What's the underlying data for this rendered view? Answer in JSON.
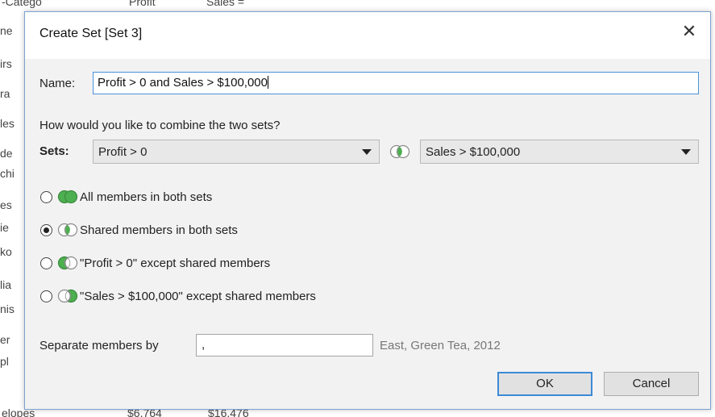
{
  "background": {
    "header_cols": [
      "-Catego",
      "Profit",
      "Sales ="
    ],
    "row_fragments": [
      "ne",
      "irs",
      "ra",
      "les",
      "de",
      "chi",
      "es",
      "ie",
      "ko",
      "lia",
      "nis",
      "er",
      "pl"
    ],
    "footer_cols": [
      "elopes",
      "$6,764",
      "$16,476"
    ]
  },
  "dialog": {
    "title": "Create Set [Set 3]",
    "close_glyph": "✕",
    "name_label": "Name:",
    "name_value": "Profit > 0 and Sales > $100,000",
    "combine_question": "How would you like to combine the two sets?",
    "sets_label": "Sets:",
    "set_left": "Profit > 0",
    "set_right": "Sales > $100,000",
    "options": [
      {
        "label": "All members in both sets",
        "selected": false,
        "venn": "all"
      },
      {
        "label": "Shared members in both sets",
        "selected": true,
        "venn": "shared"
      },
      {
        "label": "\"Profit > 0\" except shared members",
        "selected": false,
        "venn": "left"
      },
      {
        "label": "\"Sales > $100,000\" except shared members",
        "selected": false,
        "venn": "right"
      }
    ],
    "separator_label": "Separate members by",
    "separator_value": ",",
    "separator_example": "East, Green Tea, 2012",
    "ok_label": "OK",
    "cancel_label": "Cancel"
  },
  "colors": {
    "venn_green": "#4caf50",
    "venn_outline": "#8a8a8a",
    "focus_blue": "#3c8ad6"
  }
}
